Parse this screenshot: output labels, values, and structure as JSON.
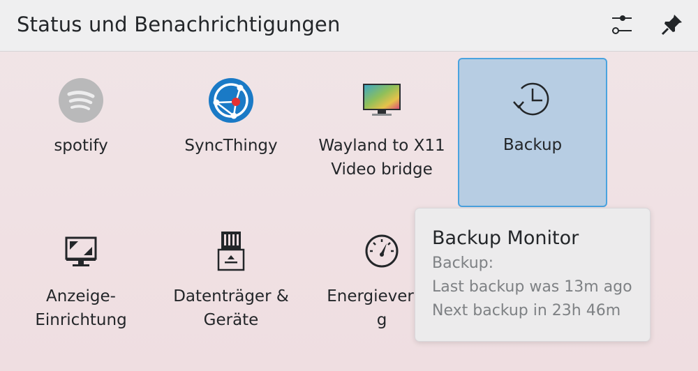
{
  "header": {
    "title": "Status und Benachrichtigungen",
    "configure_icon": "configure-sliders-icon",
    "pin_icon": "pin-icon"
  },
  "items": [
    {
      "label": "spotify",
      "icon": "spotify-icon"
    },
    {
      "label": "SyncThingy",
      "icon": "syncthingy-icon"
    },
    {
      "label": "Wayland to X11\nVideo bridge",
      "icon": "monitor-wallpaper-icon"
    },
    {
      "label": "Backup",
      "icon": "backup-clock-icon"
    },
    {
      "label": "Anzeige-\nEinrichtung",
      "icon": "display-settings-icon"
    },
    {
      "label": "Datenträger &\nGeräte",
      "icon": "drive-eject-icon"
    },
    {
      "label": "Energieverwa\ng",
      "icon": "power-gauge-icon"
    }
  ],
  "tooltip": {
    "title": "Backup Monitor",
    "line1": "Backup:",
    "line2": "Last backup was 13m ago",
    "line3": "Next backup in 23h 46m"
  },
  "colors": {
    "selected_bg": "#b7cde3",
    "selected_border": "#4aa3df",
    "syncthing_blue": "#1a7ac6",
    "syncthing_red": "#e63030"
  }
}
